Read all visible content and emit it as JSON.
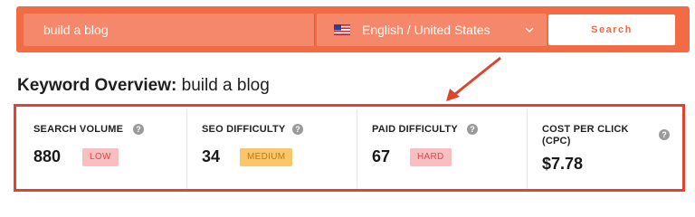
{
  "search": {
    "keyword": "build a blog",
    "language": "English / United States",
    "button_label": "Search"
  },
  "overview": {
    "title_prefix": "Keyword Overview:",
    "title_keyword": "build a blog"
  },
  "metrics": [
    {
      "label": "SEARCH VOLUME",
      "value": "880",
      "badge": "LOW",
      "info": "?"
    },
    {
      "label": "SEO DIFFICULTY",
      "value": "34",
      "badge": "MEDIUM",
      "info": "?"
    },
    {
      "label": "PAID DIFFICULTY",
      "value": "67",
      "badge": "HARD",
      "info": "?"
    },
    {
      "label_line1": "COST PER CLICK",
      "label_line2": "(CPC)",
      "value": "$7.78",
      "info": "?"
    }
  ],
  "colors": {
    "brand": "#f26b42",
    "highlight": "#e8402c",
    "badge_low": "#f8bfc0",
    "badge_medium": "#fbc56a",
    "badge_hard": "#f8bfc0"
  },
  "icons": [
    "us-flag-icon",
    "chevron-down-icon",
    "info-icon",
    "red-arrow-annotation"
  ]
}
